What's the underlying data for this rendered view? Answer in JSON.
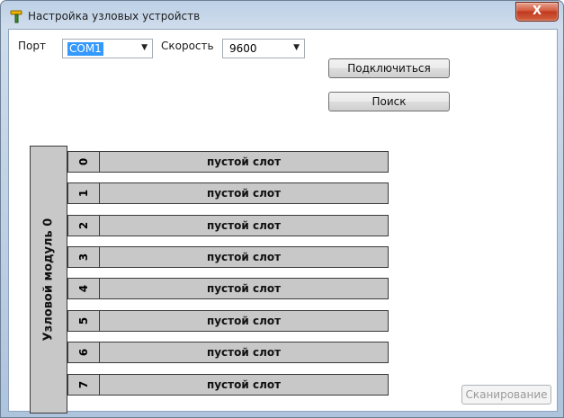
{
  "window": {
    "title": "Настройка узловых устройств",
    "close_label": "X"
  },
  "connection": {
    "port_label": "Порт",
    "port_value": "COM1",
    "speed_label": "Скорость",
    "speed_value": "9600",
    "connect_label": "Подключиться",
    "search_label": "Поиск"
  },
  "module": {
    "label": "Узловой модуль 0",
    "slots": [
      {
        "number": "0",
        "name": "пустой слот"
      },
      {
        "number": "1",
        "name": "пустой слот"
      },
      {
        "number": "2",
        "name": "пустой слот"
      },
      {
        "number": "3",
        "name": "пустой слот"
      },
      {
        "number": "4",
        "name": "пустой слот"
      },
      {
        "number": "5",
        "name": "пустой слот"
      },
      {
        "number": "6",
        "name": "пустой слот"
      },
      {
        "number": "7",
        "name": "пустой слот"
      }
    ]
  },
  "actions": {
    "scan_label": "Сканирование"
  },
  "colors": {
    "selection": "#3399ff",
    "slot_fill": "#c8c8c8",
    "close_red": "#c0391f"
  },
  "icons": {
    "title": "hammer-icon",
    "combo_arrow": "chevron-down-icon"
  }
}
